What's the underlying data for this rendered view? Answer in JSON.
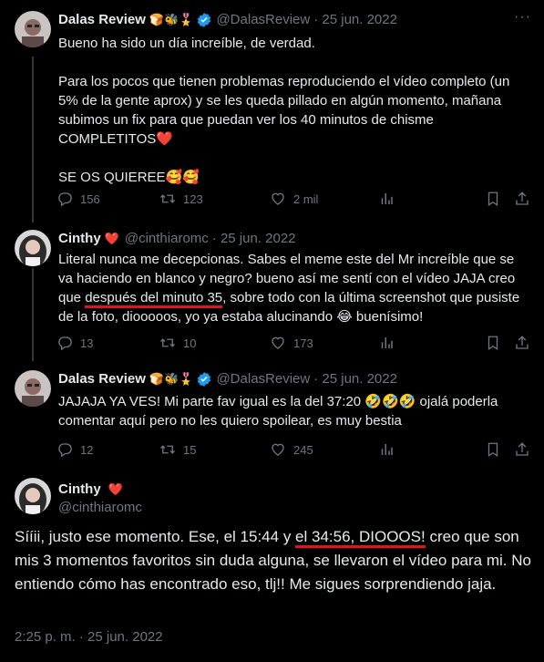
{
  "tweets": [
    {
      "name": "Dalas Review",
      "badges": "🍞🐝🎖️",
      "handle": "@DalasReview",
      "date": "· 25 jun. 2022",
      "text1": "Bueno ha sido un día increíble, de verdad.\n\nPara los pocos que tienen problemas reproduciendo el vídeo completo (un 5% de la gente aprox) y se les queda pillado en algún momento, mañana subimos un fix para que puedan ver los 40 minutos de chisme COMPLETITOS❤️\n\nSE OS QUIEREE🥰🥰",
      "replies": "156",
      "retweets": "123",
      "likes": "2 mil"
    },
    {
      "name": "Cinthy",
      "badges": "❤️",
      "handle": "@cinthiaromc",
      "date": "· 25 jun. 2022",
      "text_before": "Literal nunca me decepcionas. Sabes el meme este del Mr increíble que se va haciendo en blanco y negro? bueno así me sentí con el vídeo JAJA creo que ",
      "text_highlight": "después del minuto 35",
      "text_after": ", sobre todo con la última screenshot que pusiste de la foto, diooooos, yo ya estaba alucinando 😂 buenísimo!",
      "replies": "13",
      "retweets": "10",
      "likes": "173"
    },
    {
      "name": "Dalas Review",
      "badges": "🍞🐝🎖️",
      "handle": "@DalasReview",
      "date": "· 25 jun. 2022",
      "text1": "JAJAJA YA VES! Mi parte fav igual es la del 37:20 🤣🤣🤣 ojalá poderla comentar aquí pero no les quiero spoilear, es muy bestia",
      "replies": "12",
      "retweets": "15",
      "likes": "245"
    }
  ],
  "main": {
    "name": "Cinthy",
    "badges": "❤️",
    "handle": "@cinthiaromc",
    "text_before": "Sííii, justo ese momento. Ese, el 15:44 y ",
    "text_highlight": "el 34:56, DIOOOS!",
    "text_after": " creo que son mis 3 momentos favoritos sin duda alguna, se llevaron el vídeo para mi. No entiendo cómo has encontrado eso, tlj!! Me sigues sorprendiendo jaja.",
    "timestamp": "2:25 p. m. · 25 jun. 2022"
  },
  "colors": {
    "background": "#000000",
    "text": "#e7e9ea",
    "muted": "#71767b",
    "verified": "#1d9bf0",
    "highlight_underline": "#e0141e",
    "thread_line": "#333639"
  },
  "icons": [
    "more-icon",
    "reply-icon",
    "retweet-icon",
    "like-icon",
    "views-icon",
    "bookmark-icon",
    "share-icon",
    "verified-icon"
  ]
}
